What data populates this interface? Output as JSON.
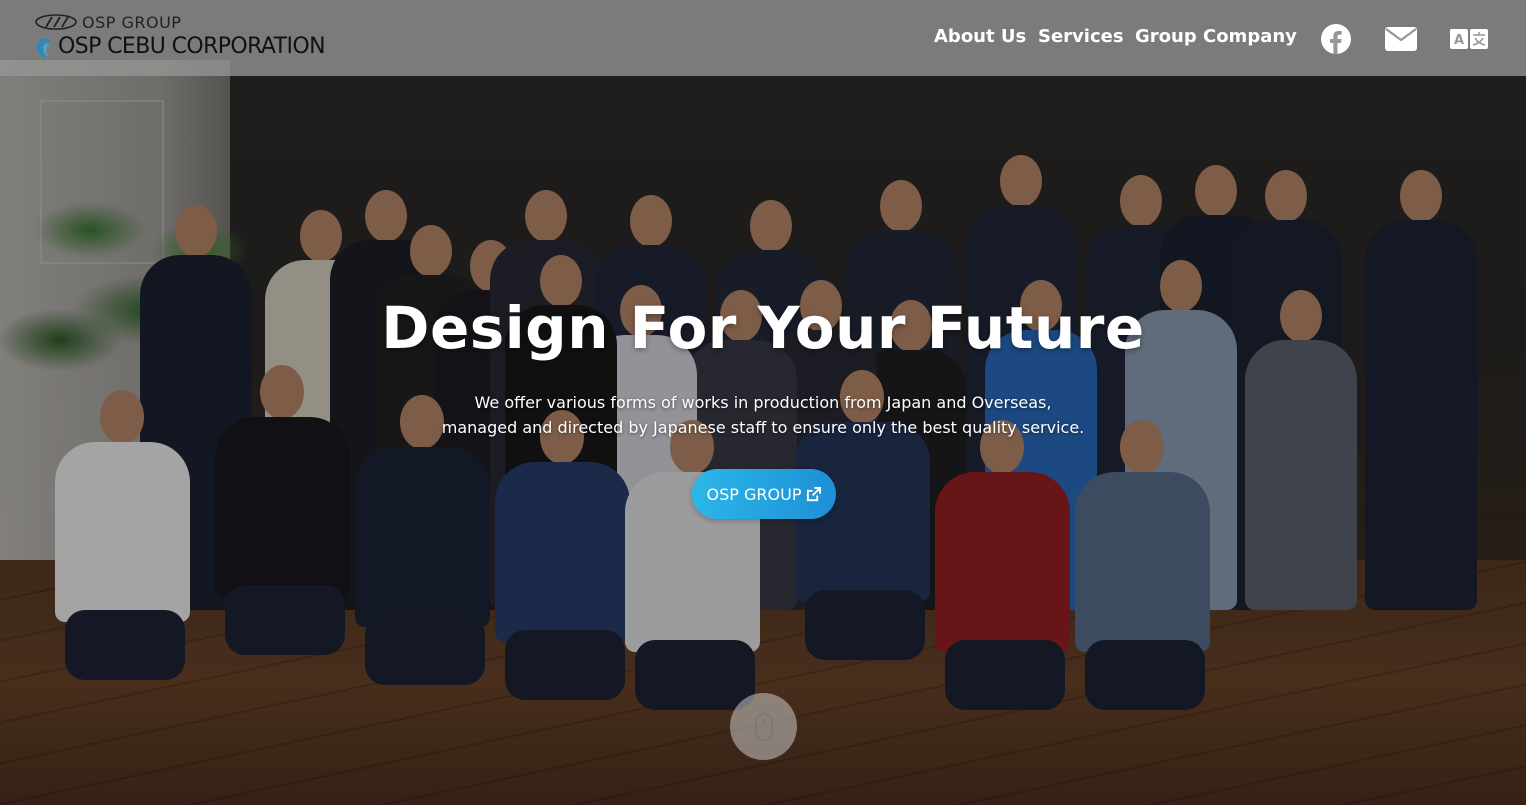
{
  "brand": {
    "group_label": "OSP GROUP",
    "company_name": "OSP CEBU CORPORATION"
  },
  "nav": {
    "about": "About Us",
    "services": "Services",
    "group_company": "Group Company"
  },
  "icons": {
    "facebook": "facebook-icon",
    "mail": "mail-icon",
    "translate": "translate-icon",
    "external_link": "external-link-icon",
    "scroll": "mouse-icon"
  },
  "hero": {
    "headline": "Design For Your Future",
    "subcopy_line1": "We offer various forms of works in production from Japan and Overseas,",
    "subcopy_line2": "managed and directed by Japanese staff to ensure only the best quality service.",
    "cta_label": "OSP GROUP"
  },
  "colors": {
    "header_bg": "#969696",
    "cta_start": "#2bb7e8",
    "cta_end": "#1e8fd6",
    "text_light": "#ffffff"
  }
}
